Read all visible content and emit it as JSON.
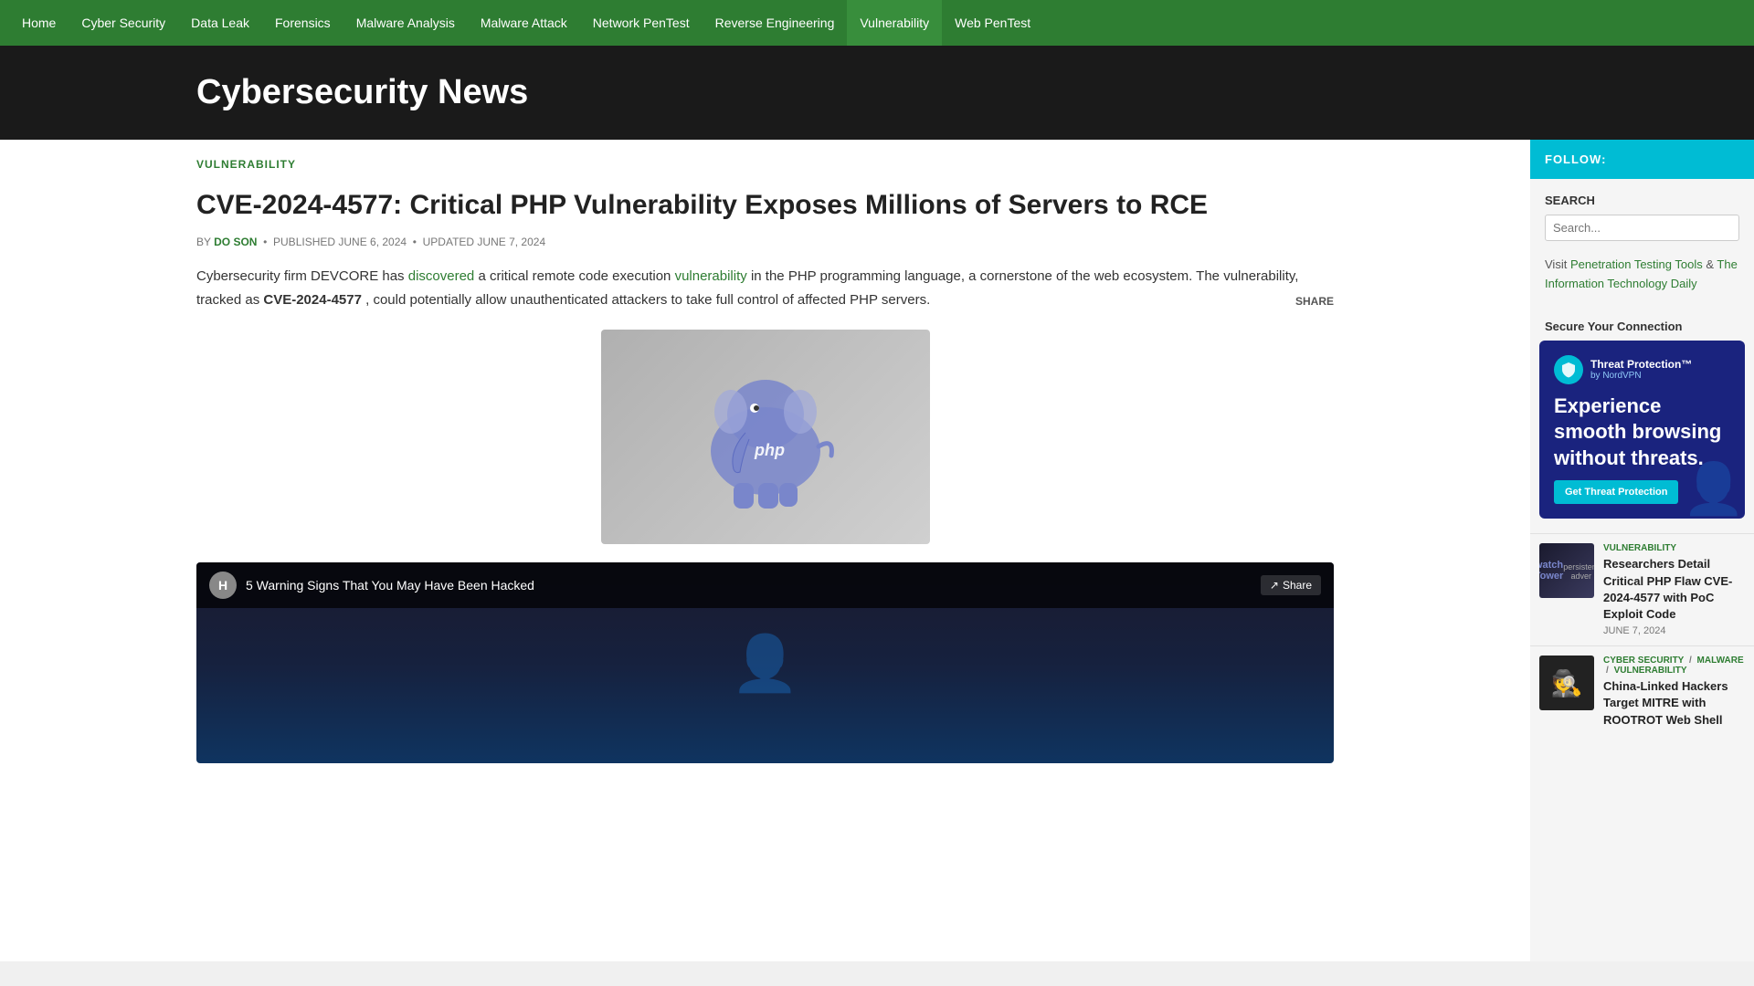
{
  "nav": {
    "items": [
      {
        "label": "Home",
        "active": false
      },
      {
        "label": "Cyber Security",
        "active": false
      },
      {
        "label": "Data Leak",
        "active": false
      },
      {
        "label": "Forensics",
        "active": false
      },
      {
        "label": "Malware Analysis",
        "active": false
      },
      {
        "label": "Malware Attack",
        "active": false
      },
      {
        "label": "Network PenTest",
        "active": false
      },
      {
        "label": "Reverse Engineering",
        "active": false
      },
      {
        "label": "Vulnerability",
        "active": true
      },
      {
        "label": "Web PenTest",
        "active": false
      }
    ]
  },
  "site": {
    "title": "Cybersecurity News"
  },
  "article": {
    "breadcrumb": "VULNERABILITY",
    "title": "CVE-2024-4577: Critical PHP Vulnerability Exposes Millions of Servers to RCE",
    "author": "DO SON",
    "published": "PUBLISHED JUNE 6, 2024",
    "updated": "UPDATED JUNE 7, 2024",
    "share_label": "SHARE",
    "body_1": "Cybersecurity firm DEVCORE has",
    "body_link1": "discovered",
    "body_1b": "a critical remote code execution",
    "body_link2": "vulnerability",
    "body_1c": "in the PHP programming language, a cornerstone of the web ecosystem. The vulnerability, tracked as",
    "body_cve": "CVE-2024-4577",
    "body_1d": ", could potentially allow unauthenticated attackers to take full control of affected PHP servers."
  },
  "video": {
    "icon": "H",
    "title": "5 Warning Signs That You May Have Been Hacked",
    "share_label": "Share"
  },
  "sidebar": {
    "follow_label": "FOLLOW:",
    "search_label": "SEARCH",
    "visit_text": "Visit",
    "visit_link1": "Penetration Testing Tools",
    "visit_text2": "&",
    "visit_link2": "The Information Technology Daily",
    "secure_title": "Secure Your Connection",
    "nordvpn": {
      "brand": "Threat Protection™",
      "subtitle": "by NordVPN",
      "tagline": "Experience smooth browsing without threats.",
      "button": "Get Threat Protection"
    },
    "related": [
      {
        "category": "VULNERABILITY",
        "category2": "",
        "category3": "",
        "title": "Researchers Detail Critical PHP Flaw CVE-2024-4577 with PoC Exploit Code",
        "date": "JUNE 7, 2024",
        "thumb_type": "watchtower"
      },
      {
        "category": "CYBER SECURITY",
        "category2": "MALWARE",
        "category3": "VULNERABILITY",
        "title": "China-Linked Hackers Target MITRE with ROOTROT Web Shell",
        "date": "",
        "thumb_type": "hacker"
      }
    ]
  }
}
